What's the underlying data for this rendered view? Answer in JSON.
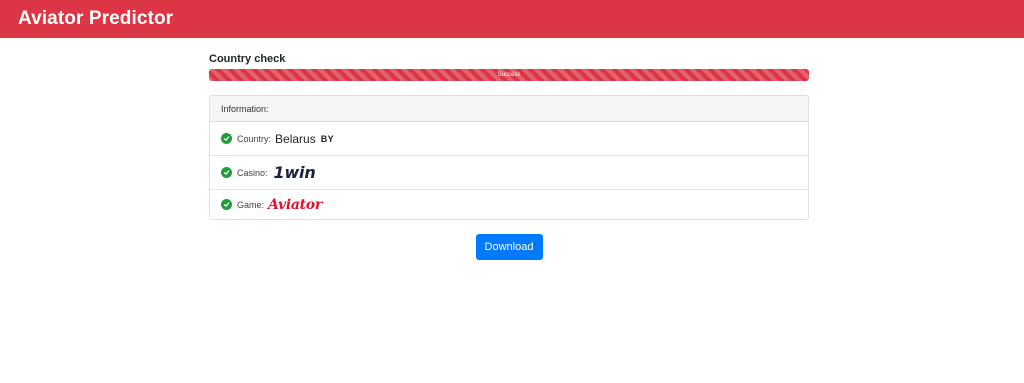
{
  "header": {
    "title": "Aviator Predictor"
  },
  "country_check": {
    "title": "Country check",
    "progress_label": "Success",
    "progress_percent": 100,
    "bar_color": "#dc3545"
  },
  "info_card": {
    "header": "Information:",
    "rows": [
      {
        "label": "Country:",
        "value": "Belarus",
        "code": "BY"
      },
      {
        "label": "Casino:",
        "logo": "1win"
      },
      {
        "label": "Game:",
        "logo": "Aviator"
      }
    ]
  },
  "download_button": {
    "label": "Download",
    "color": "#007bff"
  },
  "colors": {
    "brand": "#dc3545",
    "check": "#1f9d3a",
    "aviator": "#e8112d"
  },
  "icons": {
    "check": "check-circle-icon"
  }
}
